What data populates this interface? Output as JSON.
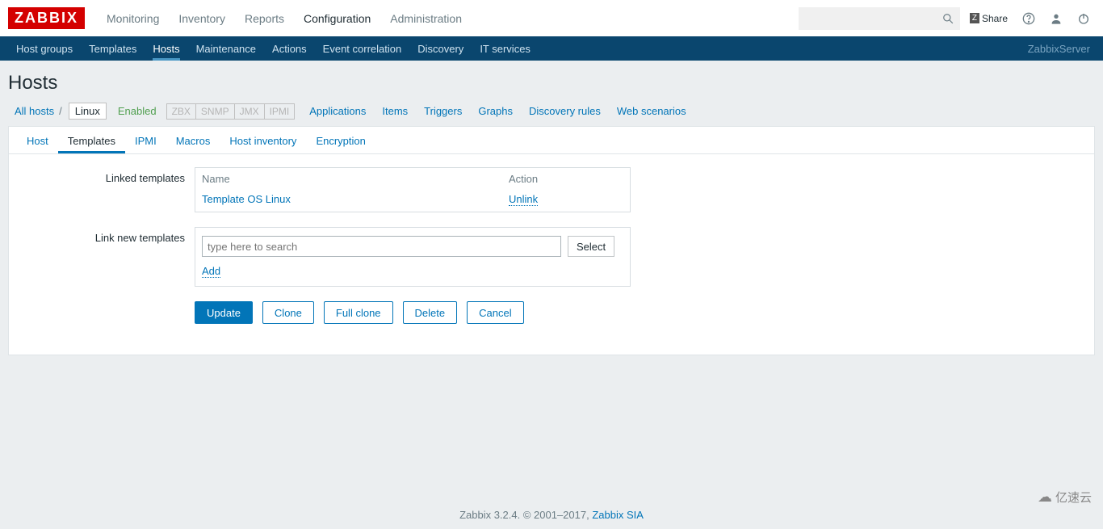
{
  "logo": "ZABBIX",
  "top_nav": {
    "items": [
      "Monitoring",
      "Inventory",
      "Reports",
      "Configuration",
      "Administration"
    ],
    "active_index": 3
  },
  "share_label": "Share",
  "sub_nav": {
    "items": [
      "Host groups",
      "Templates",
      "Hosts",
      "Maintenance",
      "Actions",
      "Event correlation",
      "Discovery",
      "IT services"
    ],
    "active_index": 2,
    "server": "ZabbixServer"
  },
  "page_title": "Hosts",
  "breadcrumb": {
    "all_hosts": "All hosts",
    "host": "Linux",
    "status": "Enabled",
    "protocols": [
      "ZBX",
      "SNMP",
      "JMX",
      "IPMI"
    ],
    "links": [
      "Applications",
      "Items",
      "Triggers",
      "Graphs",
      "Discovery rules",
      "Web scenarios"
    ]
  },
  "tabs": {
    "items": [
      "Host",
      "Templates",
      "IPMI",
      "Macros",
      "Host inventory",
      "Encryption"
    ],
    "active_index": 1
  },
  "form": {
    "linked_label": "Linked templates",
    "name_header": "Name",
    "action_header": "Action",
    "linked_template_name": "Template OS Linux",
    "unlink_label": "Unlink",
    "link_new_label": "Link new templates",
    "search_placeholder": "type here to search",
    "select_label": "Select",
    "add_label": "Add"
  },
  "buttons": {
    "update": "Update",
    "clone": "Clone",
    "full_clone": "Full clone",
    "delete": "Delete",
    "cancel": "Cancel"
  },
  "footer": {
    "text": "Zabbix 3.2.4. © 2001–2017, ",
    "link": "Zabbix SIA"
  },
  "watermark": "亿速云"
}
